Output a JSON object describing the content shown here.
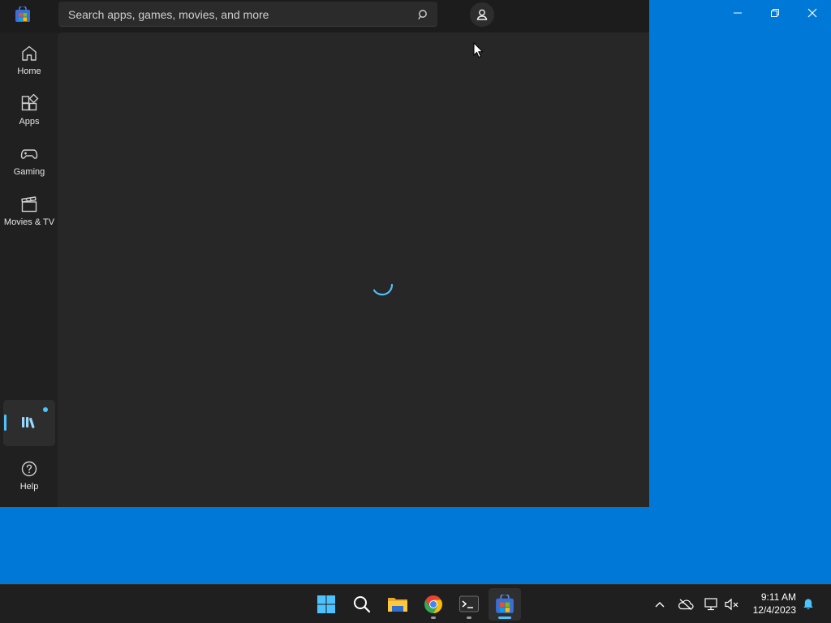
{
  "search": {
    "placeholder": "Search apps, games, movies, and more"
  },
  "nav": {
    "home": "Home",
    "apps": "Apps",
    "gaming": "Gaming",
    "movies": "Movies & TV",
    "help": "Help"
  },
  "status": {
    "loading": true
  },
  "clock": {
    "time": "9:11 AM",
    "date": "12/4/2023"
  },
  "colors": {
    "desktop": "#0078d7",
    "accent": "#4cc2ff",
    "app_bg": "#202020"
  },
  "icons": {
    "window": [
      "minimize-icon",
      "restore-icon",
      "close-icon"
    ],
    "taskbar": [
      "windows-start-icon",
      "search-icon",
      "file-explorer-icon",
      "chrome-icon",
      "terminal-icon",
      "microsoft-store-icon"
    ],
    "tray": [
      "chevron-up-icon",
      "onedrive-offline-icon",
      "network-icon",
      "volume-muted-icon",
      "notification-bell-icon"
    ]
  }
}
